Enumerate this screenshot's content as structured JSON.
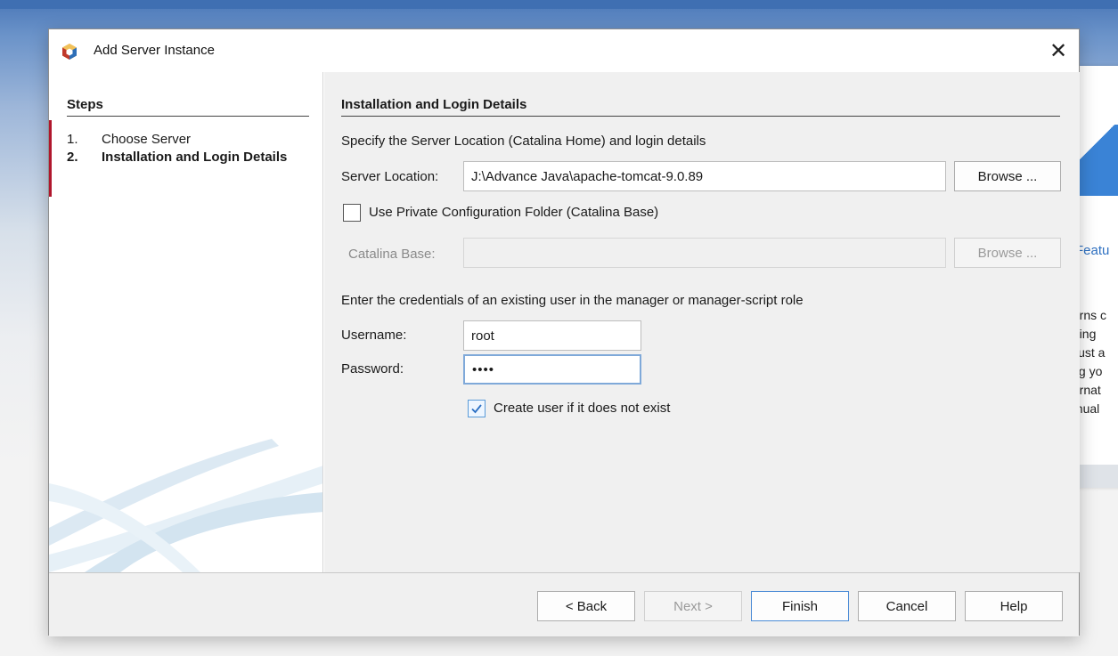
{
  "window": {
    "title": "Add Server Instance",
    "close_glyph": "✕"
  },
  "steps": {
    "header": "Steps",
    "items": [
      {
        "num": "1.",
        "label": "Choose Server"
      },
      {
        "num": "2.",
        "label": "Installation and Login Details"
      }
    ],
    "current_index": 1
  },
  "panel": {
    "title": "Installation and Login Details",
    "location_desc": "Specify the Server Location (Catalina Home) and login details",
    "server_location_label": "Server Location:",
    "server_location_value": "J:\\Advance Java\\apache-tomcat-9.0.89",
    "browse_label": "Browse ...",
    "private_config_label": "Use Private Configuration Folder (Catalina Base)",
    "private_config_checked": false,
    "catalina_base_label": "Catalina Base:",
    "catalina_base_value": "",
    "browse_disabled_label": "Browse ...",
    "credentials_desc": "Enter the credentials of an existing user in the manager or manager-script role",
    "username_label": "Username:",
    "username_value": "root",
    "password_label": "Password:",
    "password_mask": "••••",
    "create_user_label": "Create user if it does not exist",
    "create_user_checked": true
  },
  "footer": {
    "back": "< Back",
    "next": "Next >",
    "finish": "Finish",
    "cancel": "Cancel",
    "help": "Help"
  },
  "background": {
    "feature_link": "Featu",
    "text_lines": [
      "turns c",
      "ating",
      "l just a",
      "ing yo",
      "ternat",
      "anual"
    ]
  },
  "icons": {
    "app": "netbeans-cube-icon",
    "close": "close-icon",
    "check": "checkmark-icon"
  },
  "colors": {
    "accent_red": "#b0162c",
    "focus_blue": "#7fa9d9",
    "default_button_border": "#4b8bd6",
    "desktop_blue": "#4b78b8"
  }
}
